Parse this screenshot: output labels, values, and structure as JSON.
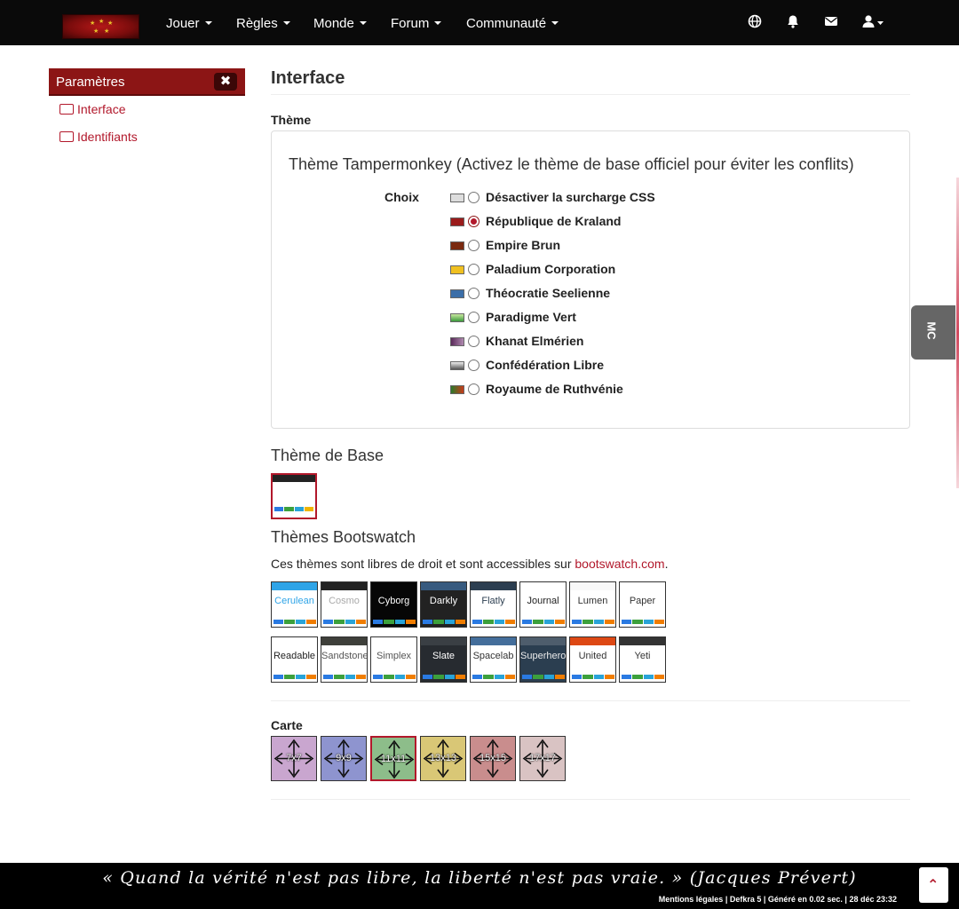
{
  "nav": {
    "items": [
      {
        "label": "Jouer"
      },
      {
        "label": "Règles"
      },
      {
        "label": "Monde"
      },
      {
        "label": "Forum"
      },
      {
        "label": "Communauté"
      }
    ],
    "icons": [
      "globe-icon",
      "bell-icon",
      "envelope-icon",
      "user-icon"
    ]
  },
  "sidebar": {
    "header": "Paramètres",
    "close_symbol": "✖",
    "links": [
      {
        "label": "Interface",
        "icon": "images-icon"
      },
      {
        "label": "Identifiants",
        "icon": "id-card-icon"
      }
    ]
  },
  "main": {
    "title": "Interface",
    "theme_label": "Thème",
    "panel_heading": "Thème Tampermonkey (Activez le thème de base officiel pour éviter les conflits)",
    "choix_label": "Choix",
    "options": [
      {
        "label": "Désactiver la surcharge CSS",
        "checked": false
      },
      {
        "label": "République de Kraland",
        "checked": true
      },
      {
        "label": "Empire Brun",
        "checked": false
      },
      {
        "label": "Paladium Corporation",
        "checked": false
      },
      {
        "label": "Théocratie Seelienne",
        "checked": false
      },
      {
        "label": "Paradigme Vert",
        "checked": false
      },
      {
        "label": "Khanat Elmérien",
        "checked": false
      },
      {
        "label": "Confédération Libre",
        "checked": false
      },
      {
        "label": "Royaume de Ruthvénie",
        "checked": false
      }
    ],
    "base_theme_heading": "Thème de Base",
    "bootswatch_heading": "Thèmes Bootswatch",
    "bootswatch_desc": "Ces thèmes sont libres de droit et sont accessibles sur",
    "bootswatch_link": "bootswatch.com",
    "bootswatch_desc_end": ".",
    "themes": [
      {
        "name": "Cerulean",
        "colors": [
          "#2fa4e7",
          "#ffffff",
          "#2fa4e7"
        ]
      },
      {
        "name": "Cosmo",
        "colors": [
          "#222222",
          "#ffffff",
          "#aaaaaa"
        ]
      },
      {
        "name": "Cyborg",
        "colors": [
          "#060606",
          "#060606",
          "#ffffff"
        ]
      },
      {
        "name": "Darkly",
        "colors": [
          "#375a7f",
          "#222222",
          "#ffffff"
        ]
      },
      {
        "name": "Flatly",
        "colors": [
          "#2c3e50",
          "#ffffff",
          "#2c3e50"
        ]
      },
      {
        "name": "Journal",
        "colors": [
          "#ffffff",
          "#ffffff",
          "#222222"
        ]
      },
      {
        "name": "Lumen",
        "colors": [
          "#f8f8f8",
          "#ffffff",
          "#333333"
        ]
      },
      {
        "name": "Paper",
        "colors": [
          "#ffffff",
          "#ffffff",
          "#333333"
        ]
      },
      {
        "name": "Readable",
        "colors": [
          "#ffffff",
          "#ffffff",
          "#222222"
        ]
      },
      {
        "name": "Sandstone",
        "colors": [
          "#3e3f3a",
          "#ffffff",
          "#555555"
        ]
      },
      {
        "name": "Simplex",
        "colors": [
          "#ffffff",
          "#ffffff",
          "#555555"
        ]
      },
      {
        "name": "Slate",
        "colors": [
          "#3a3f44",
          "#272b30",
          "#ffffff"
        ]
      },
      {
        "name": "Spacelab",
        "colors": [
          "#446e9b",
          "#ffffff",
          "#333333"
        ]
      },
      {
        "name": "Superhero",
        "colors": [
          "#4e5d6c",
          "#2b3e50",
          "#ebebeb"
        ]
      },
      {
        "name": "United",
        "colors": [
          "#dd4814",
          "#ffffff",
          "#333333"
        ]
      },
      {
        "name": "Yeti",
        "colors": [
          "#333333",
          "#ffffff",
          "#333333"
        ]
      }
    ],
    "carte_label": "Carte",
    "maps": [
      {
        "label": "7x7",
        "color": "#c9a6cf",
        "selected": false
      },
      {
        "label": "9x9",
        "color": "#8e94cf",
        "selected": false
      },
      {
        "label": "11x11",
        "color": "#8dbd8a",
        "selected": true
      },
      {
        "label": "13x13",
        "color": "#d9c776",
        "selected": false
      },
      {
        "label": "15x15",
        "color": "#c98d8d",
        "selected": false
      },
      {
        "label": "17x17",
        "color": "#d9c3c3",
        "selected": false
      }
    ]
  },
  "side_tab": {
    "label": "MC"
  },
  "footer": {
    "quote": "« Quand la vérité n'est pas libre, la liberté n'est pas vraie. » (Jacques Prévert)",
    "small": "Mentions légales | Defkra 5 | Généré en 0.02 sec. | 28 déc 23:32",
    "top_symbol": "⌃"
  },
  "colors": {
    "accent": "#b2182b",
    "sidebar": "#8c1515",
    "navbar": "#0a0a0a"
  }
}
